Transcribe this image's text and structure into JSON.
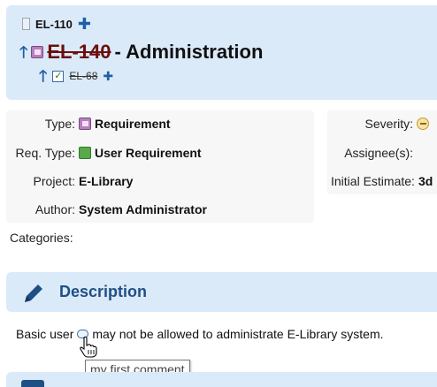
{
  "header": {
    "parent_id": "EL-110",
    "item_id": "EL-140",
    "title_suffix": " - Administration",
    "child_id": "EL-68"
  },
  "properties_left": [
    {
      "label": "Type:",
      "value": "Requirement",
      "icon": "requirement-icon"
    },
    {
      "label": "Req. Type:",
      "value": "User Requirement",
      "icon": "user-requirement-icon"
    },
    {
      "label": "Project:",
      "value": "E-Library"
    },
    {
      "label": "Author:",
      "value": "System Administrator"
    }
  ],
  "properties_right": [
    {
      "label": "Severity:",
      "value": "",
      "icon": "severity-icon"
    },
    {
      "label": "Assignee(s):",
      "value": ""
    },
    {
      "label": "Initial Estimate:",
      "value": "3d"
    }
  ],
  "categories_label": "Categories:",
  "description": {
    "section_title": "Description",
    "text_before": "Basic user",
    "text_after": "may not be allowed to administrate E-Library system.",
    "comment_tooltip": "my first comment"
  },
  "colors": {
    "panel_blue": "#dbeaf8",
    "link_blue": "#1f5fa8",
    "heading_blue": "#1f4f85",
    "strike_red": "#6a0f0f"
  }
}
